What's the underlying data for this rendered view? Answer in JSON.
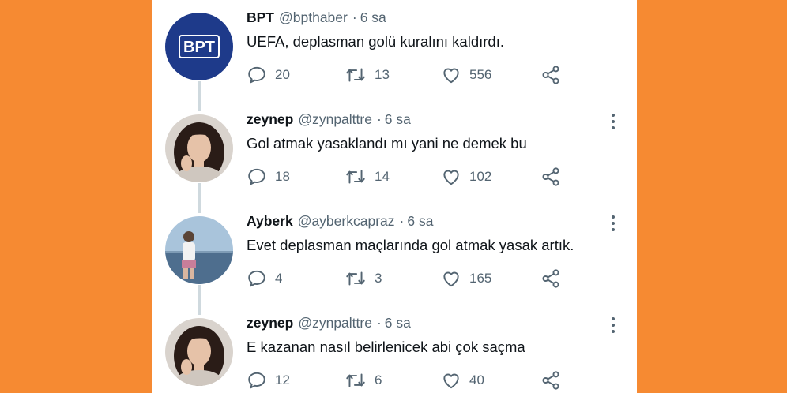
{
  "tweets": [
    {
      "name": "BPT",
      "handle": "@bpthaber",
      "time": "6 sa",
      "text": "UEFA, deplasman golü kuralını kaldırdı.",
      "replies": "20",
      "retweets": "13",
      "likes": "556",
      "avatar_text": "BPT"
    },
    {
      "name": "zeynep",
      "handle": "@zynpalttre",
      "time": "6 sa",
      "text": "Gol atmak yasaklandı mı yani ne demek bu",
      "replies": "18",
      "retweets": "14",
      "likes": "102"
    },
    {
      "name": "Ayberk",
      "handle": "@ayberkcapraz",
      "time": "6 sa",
      "text": "Evet deplasman maçlarında gol atmak yasak artık.",
      "replies": "4",
      "retweets": "3",
      "likes": "165"
    },
    {
      "name": "zeynep",
      "handle": "@zynpalttre",
      "time": "6 sa",
      "text": "E kazanan nasıl belirlenicek abi çok saçma",
      "replies": "12",
      "retweets": "6",
      "likes": "40"
    }
  ],
  "colors": {
    "background": "#F68A32",
    "bpt_avatar": "#1E3A8A",
    "text": "#0F1419",
    "muted": "#536471"
  },
  "icons": [
    "reply-icon",
    "retweet-icon",
    "like-icon",
    "share-icon",
    "more-options-icon"
  ]
}
